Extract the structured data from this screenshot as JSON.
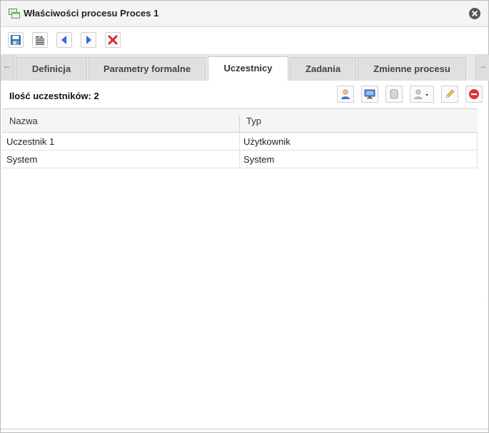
{
  "window": {
    "title": "Właściwości procesu Proces 1",
    "accent": "#3a7bd5"
  },
  "toolbar": {
    "buttons": [
      {
        "name": "save-icon"
      },
      {
        "name": "properties-icon"
      },
      {
        "name": "previous-arrow-icon"
      },
      {
        "name": "next-arrow-icon"
      },
      {
        "name": "delete-cross-icon"
      }
    ]
  },
  "tabs": {
    "items": [
      {
        "label": "Definicja",
        "active": false
      },
      {
        "label": "Parametry formalne",
        "active": false
      },
      {
        "label": "Uczestnicy",
        "active": true
      },
      {
        "label": "Zadania",
        "active": false
      },
      {
        "label": "Zmienne procesu",
        "active": false
      }
    ],
    "scroll_left": "←",
    "scroll_right": "→"
  },
  "participants": {
    "count_label": "Ilość uczestników: 2",
    "actions": [
      {
        "name": "add-user-icon"
      },
      {
        "name": "add-system-icon"
      },
      {
        "name": "add-resource-icon"
      },
      {
        "name": "add-role-dropdown-icon"
      },
      {
        "name": "edit-pencil-icon"
      },
      {
        "name": "remove-icon"
      }
    ]
  },
  "table": {
    "columns": [
      "Nazwa",
      "Typ"
    ],
    "rows": [
      [
        "Uczestnik 1",
        "Użytkownik"
      ],
      [
        "System",
        "System"
      ]
    ]
  }
}
